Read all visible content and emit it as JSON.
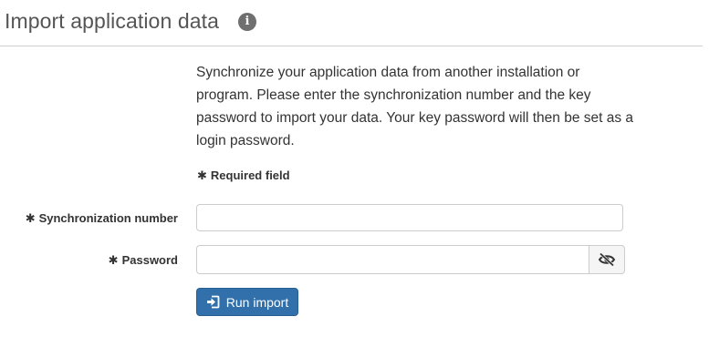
{
  "header": {
    "title": "Import application data",
    "info_icon": "info-circle-icon",
    "info_glyph": "i"
  },
  "form": {
    "intro": "Synchronize your application data from another installation or program. Please enter the synchronization number and the key password to import your data. Your key password will then be set as a login password.",
    "required_marker": "✱",
    "required_note": "Required field",
    "fields": [
      {
        "label": "Synchronization number",
        "value": "",
        "placeholder": ""
      },
      {
        "label": "Password",
        "value": "",
        "placeholder": ""
      }
    ],
    "password_toggle_icon": "eye-slash-icon",
    "submit": {
      "label": "Run import",
      "icon": "sign-in-icon",
      "color": "#3170ab"
    }
  }
}
